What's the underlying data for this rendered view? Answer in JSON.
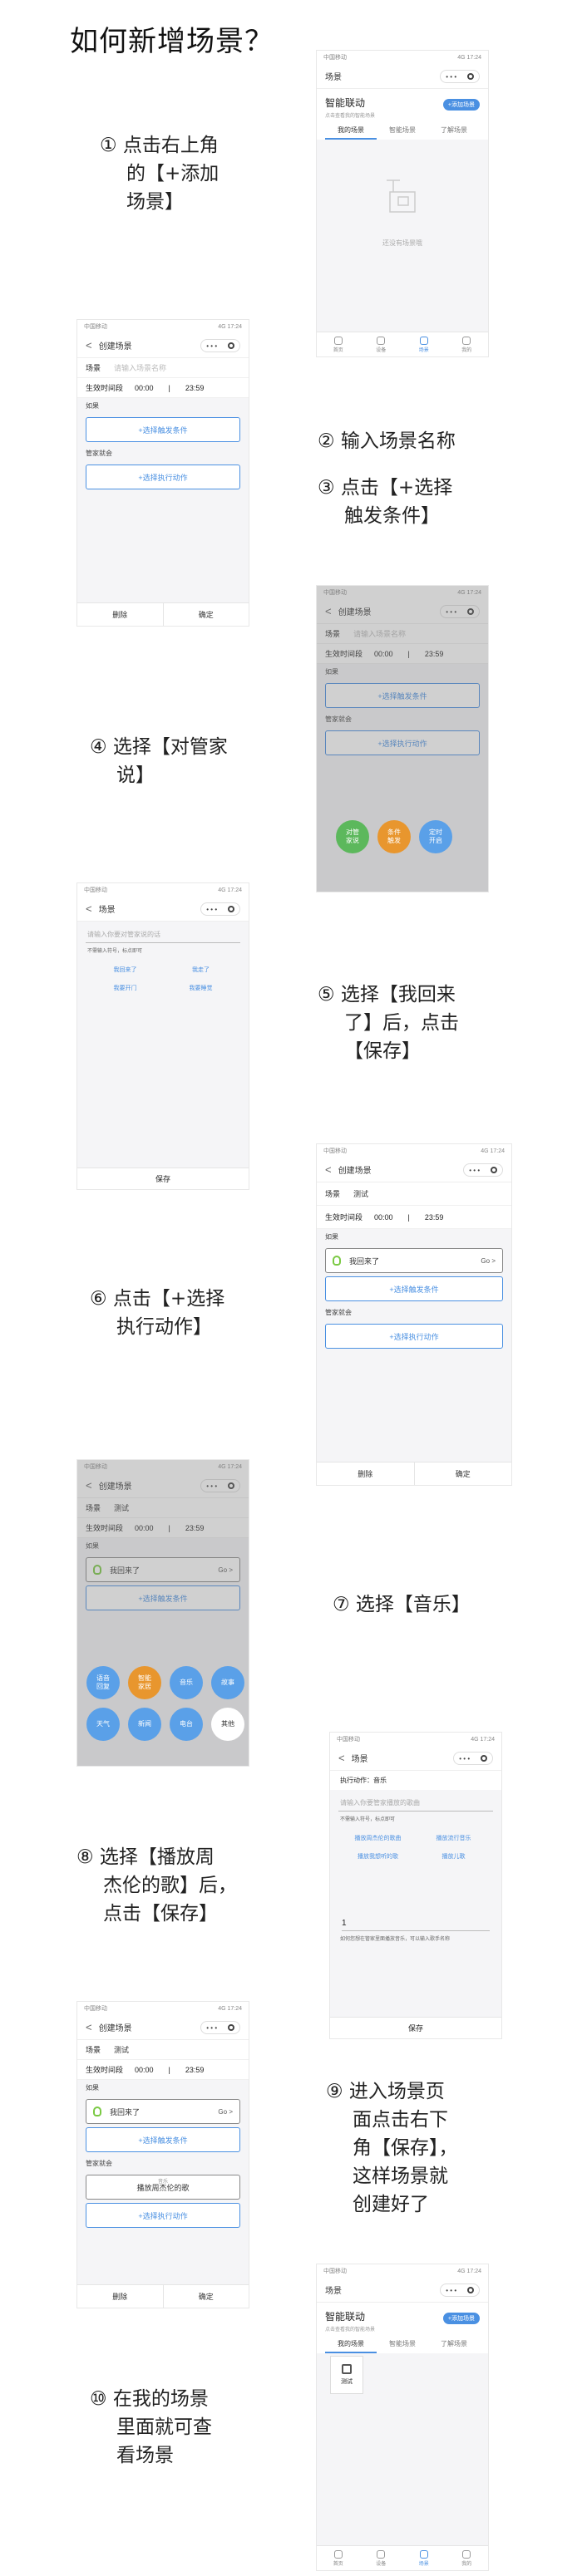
{
  "title": "如何新增场景？",
  "steps": {
    "s1": [
      "① 点击右上角",
      "的【+添加",
      "场景】"
    ],
    "s2": [
      "② 输入场景名称"
    ],
    "s3": [
      "③ 点击【+选择",
      "触发条件】"
    ],
    "s4": [
      "④ 选择【对管家",
      "说】"
    ],
    "s5": [
      "⑤ 选择【我回来",
      "了】后，点击",
      "【保存】"
    ],
    "s6": [
      "⑥ 点击【+选择",
      "执行动作】"
    ],
    "s7": [
      "⑦ 选择【音乐】"
    ],
    "s8": [
      "⑧ 选择【播放周",
      "杰伦的歌】后，",
      "点击【保存】"
    ],
    "s9": [
      "⑨ 进入场景页",
      "面点击右下",
      "角【保存】，",
      "这样场景就",
      "创建好了"
    ],
    "s10": [
      "⑩ 在我的场景",
      "里面就可查",
      "看场景"
    ]
  },
  "common": {
    "status_carrier": "中国移动",
    "status_right": "4G 17:24",
    "capsule_more": "• • •",
    "back": "<",
    "create_scene": "创建场景",
    "scene": "场景",
    "scene_placeholder": "请输入场景名称",
    "scene_name_value": "测试",
    "effective_time": "生效时间段",
    "time_start": "00:00",
    "time_sep": "|",
    "time_end": "23:59",
    "if_label": "如果",
    "butler_label": "管家就会",
    "select_trigger": "+选择触发条件",
    "select_action": "+选择执行动作",
    "delete": "删除",
    "confirm": "确定",
    "save": "保存",
    "trigger_value": "我回来了",
    "go": "Go",
    "go_arrow": ">"
  },
  "scene_list": {
    "nav_title": "场景",
    "heading": "智能联动",
    "sub": "点击查看我的智能场景",
    "add_button": "+添加场景",
    "tabs": [
      "我的场景",
      "智能场景",
      "了解场景"
    ],
    "empty_text": "还没有场景哦",
    "card_label": "测试",
    "tabbar": [
      "首页",
      "设备",
      "场景",
      "我的"
    ]
  },
  "trigger_circles": [
    {
      "label": "对管\n家说",
      "color": "#5cb85c"
    },
    {
      "label": "条件\n触发",
      "color": "#e8962e"
    },
    {
      "label": "定时\n开启",
      "color": "#5aa0e8"
    }
  ],
  "say_page": {
    "placeholder": "请输入你要对管家说的话",
    "hint": "不需输入符号，标点即可",
    "chips": [
      "我回来了",
      "我走了",
      "我要开门",
      "我要睡觉"
    ]
  },
  "action_circles": [
    {
      "label": "语音\n回复",
      "color": "#5aa0e8"
    },
    {
      "label": "智能\n家居",
      "color": "#e8962e"
    },
    {
      "label": "音乐",
      "color": "#5aa0e8"
    },
    {
      "label": "故事",
      "color": "#5aa0e8"
    },
    {
      "label": "天气",
      "color": "#5aa0e8"
    },
    {
      "label": "新闻",
      "color": "#5aa0e8"
    },
    {
      "label": "电台",
      "color": "#5aa0e8"
    },
    {
      "label": "其他",
      "color": "#ffffff"
    }
  ],
  "music_page": {
    "header": "执行动作：音乐",
    "placeholder": "请输入你要管家播放的歌曲",
    "hint": "不需输入符号，标点即可",
    "chips": [
      "播放周杰伦的歌曲",
      "播放流行音乐",
      "播放我想听的歌",
      "播放儿歌"
    ],
    "count": "1",
    "note": "如何您想在管家里面播放音乐，可以输入歌手名称"
  },
  "final_scene": {
    "action_small": "音乐",
    "action_value": "播放周杰伦的歌"
  }
}
